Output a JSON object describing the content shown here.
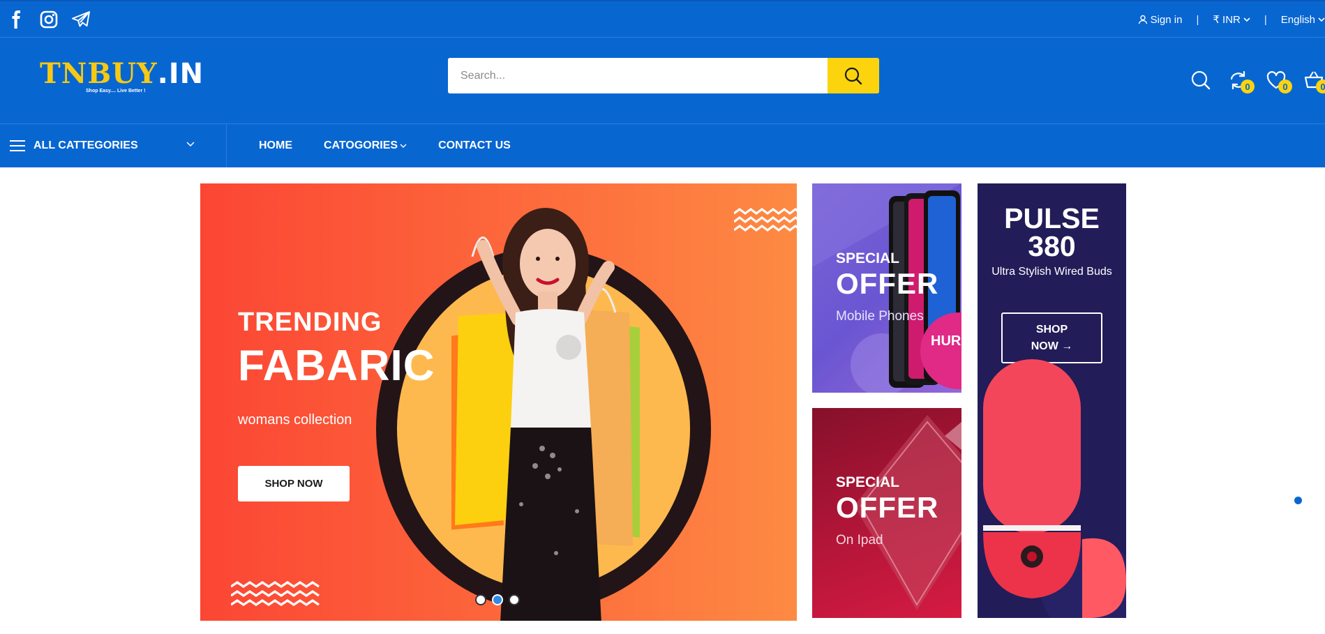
{
  "topbar": {
    "social": [
      "facebook-icon",
      "instagram-icon",
      "telegram-icon"
    ],
    "signin_label": "Sign in",
    "currency_label": "₹ INR",
    "language_label": "English",
    "separator": "|"
  },
  "header": {
    "logo_main": "TNBUY",
    "logo_dot": ".IN",
    "logo_tagline": "Shop Easy.... Live Better !",
    "search_placeholder": "Search...",
    "compare_count": "0",
    "wishlist_count": "0",
    "cart_count": "0"
  },
  "nav": {
    "all_categories_label": "ALL CATTEGORIES",
    "menu": [
      {
        "label": "HOME"
      },
      {
        "label": "CATOGORIES"
      },
      {
        "label": "CONTACT US"
      }
    ]
  },
  "hero": {
    "line1": "TRENDING",
    "line2": "FABARIC",
    "line3": "womans collection",
    "button_label": "SHOP NOW",
    "slides": 3,
    "active_slide": 1
  },
  "banner_mobile": {
    "line1": "SPECIAL",
    "line2": "OFFER",
    "line3": "Mobile Phones",
    "sticker": "HURRY UP"
  },
  "banner_ipad": {
    "line1": "SPECIAL",
    "line2": "OFFER",
    "line3": "On Ipad"
  },
  "banner_pulse": {
    "title_line1": "PULSE",
    "title_line2": "380",
    "subtitle": "Ultra Stylish Wired Buds",
    "button_line1": "SHOP",
    "button_line2": "NOW →"
  },
  "colors": {
    "brand_blue": "#0866d1",
    "accent_yellow": "#fbd40e",
    "hero_orange": "#fd6a3c",
    "pulse_navy": "#221c58"
  }
}
